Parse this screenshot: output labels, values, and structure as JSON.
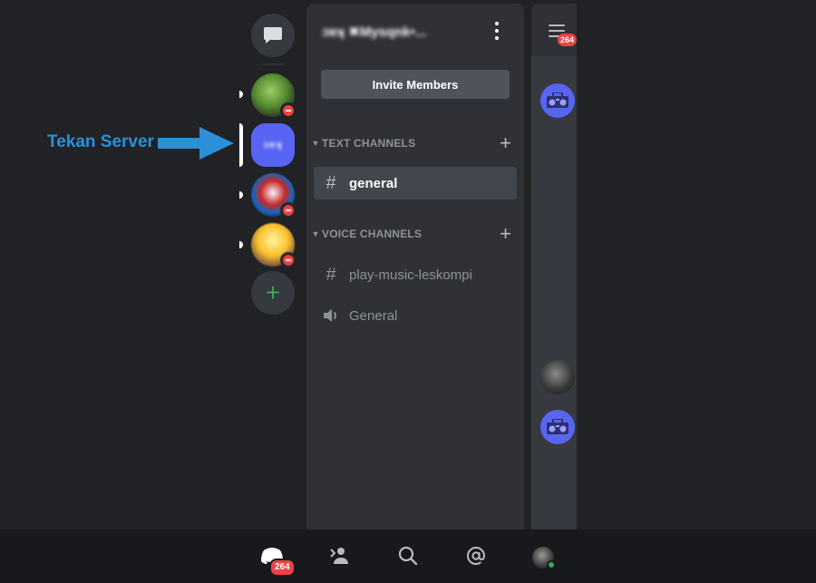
{
  "annotation": {
    "text": "Tekan Server"
  },
  "server_rail": {
    "dm_icon": "chat-bubble-icon",
    "selected_server_label": "ɔɐʞ",
    "add_server_icon": "plus-icon",
    "add_server_symbol": "+"
  },
  "channel_panel": {
    "server_name": "ɔɐʞ ✖Mysqnk•...",
    "invite_button": "Invite Members",
    "categories": [
      {
        "label": "TEXT CHANNELS",
        "add_symbol": "+",
        "channels": [
          {
            "label": "general",
            "icon": "#",
            "active": true
          }
        ]
      },
      {
        "label": "VOICE CHANNELS",
        "add_symbol": "+",
        "channels": [
          {
            "label": "play-music-leskompi",
            "icon": "#",
            "active": false
          },
          {
            "label": "General",
            "icon": "speaker-icon",
            "active": false
          }
        ]
      }
    ]
  },
  "right_panel": {
    "unread_badge": "264"
  },
  "bottom_nav": {
    "items": [
      "home-icon",
      "friends-icon",
      "search-icon",
      "mentions-icon",
      "profile-avatar"
    ],
    "home_badge": "264"
  },
  "colors": {
    "background": "#202225",
    "panel": "#2f3136",
    "accent": "#5865f2",
    "badge": "#ed4245",
    "online": "#3ba55d",
    "annotation": "#2b90d9"
  }
}
